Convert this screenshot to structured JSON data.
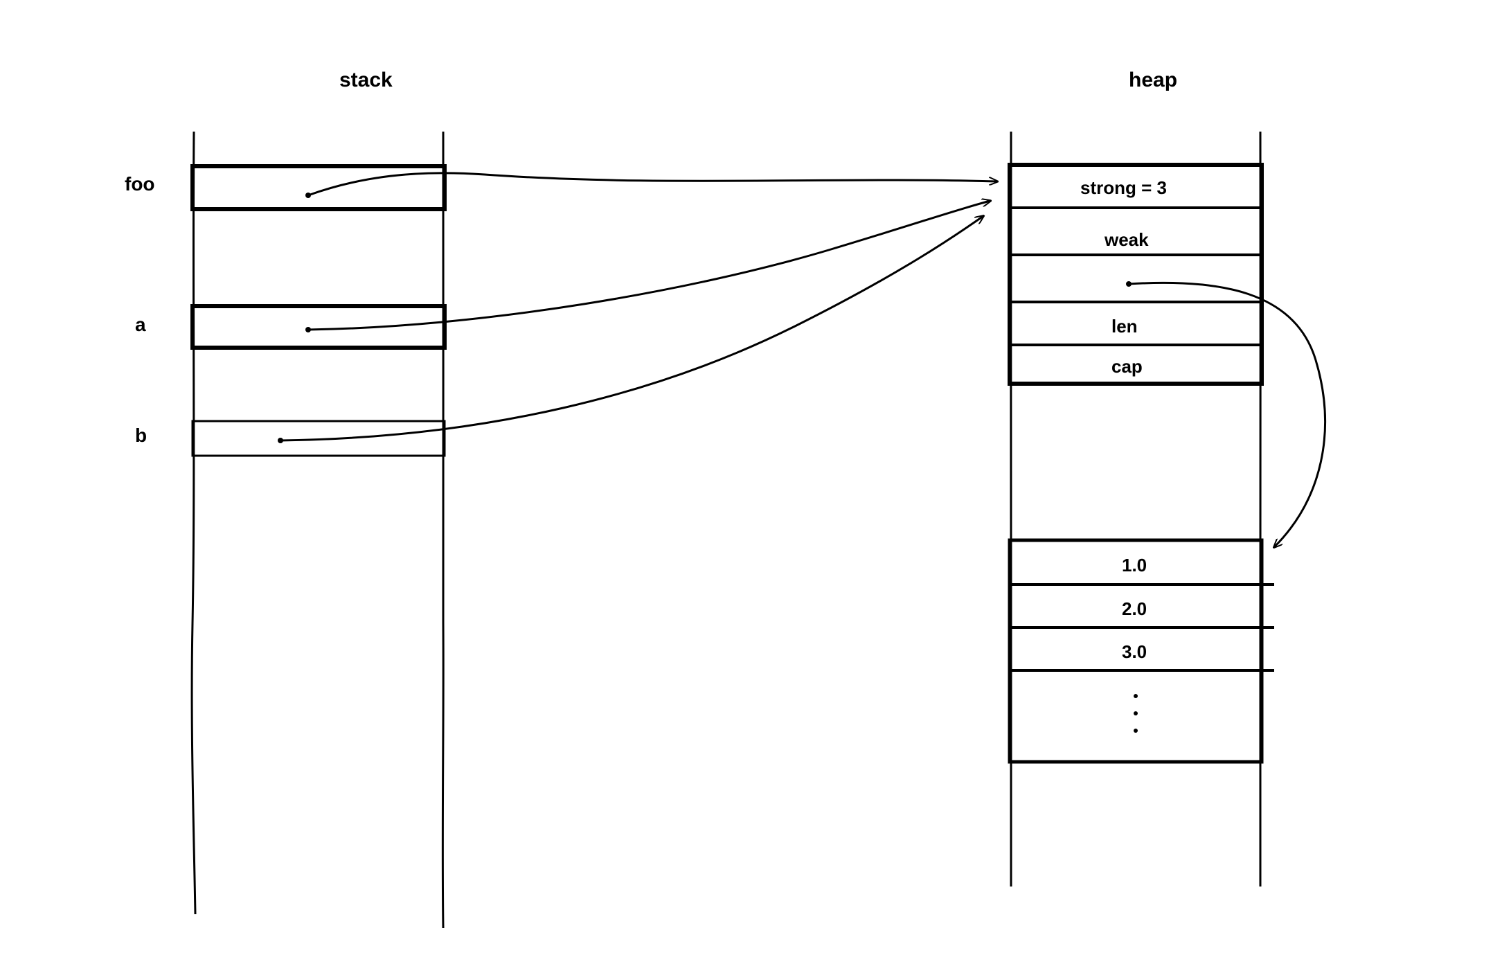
{
  "titles": {
    "stack": "stack",
    "heap": "heap"
  },
  "stack_vars": {
    "foo": "foo",
    "a": "a",
    "b": "b"
  },
  "heap_rc": {
    "strong": "strong = 3",
    "weak": "weak",
    "len": "len",
    "cap": "cap"
  },
  "heap_data": {
    "v1": "1.0",
    "v2": "2.0",
    "v3": "3.0",
    "ellipsis": "⋮"
  }
}
